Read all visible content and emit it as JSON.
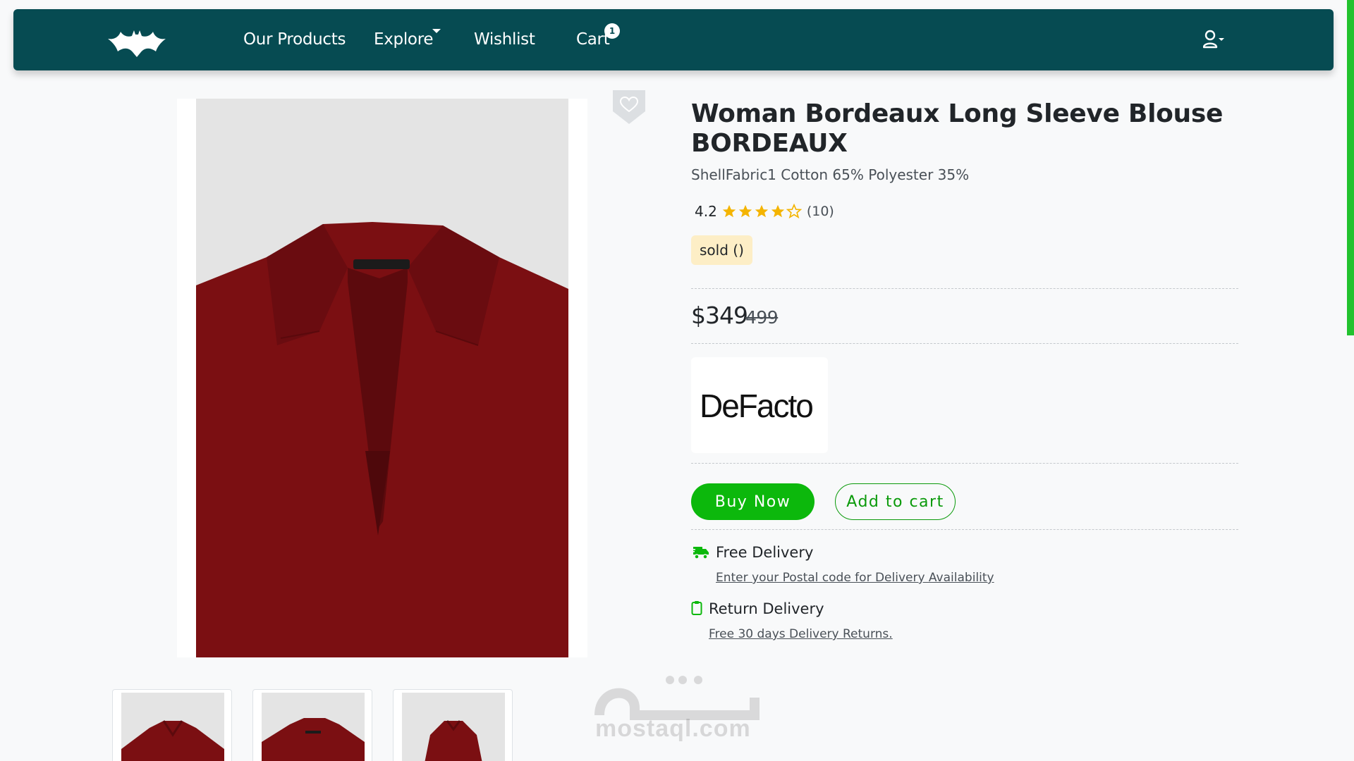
{
  "nav": {
    "logo_icon": "bat-logo-icon",
    "links": [
      "Our Products",
      "Explore",
      "Wishlist",
      "Cart"
    ],
    "cart_count": "1",
    "user_icon": "user-icon"
  },
  "product": {
    "title": "Woman Bordeaux Long Sleeve Blouse BORDEAUX",
    "material": "ShellFabric1 Cotton 65% Polyester 35%",
    "rating": "4.2",
    "rating_stars": 4.2,
    "rating_count": "(10)",
    "sold_label": "sold ()",
    "price": "$349",
    "old_price": "499",
    "brand": "DeFacto",
    "shirt_color": "#7b0f12"
  },
  "actions": {
    "buy_now": "Buy Now",
    "add_to_cart": "Add to cart"
  },
  "delivery": {
    "free_title": "Free Delivery",
    "free_link": "Enter your Postal code for Delivery Availability",
    "return_title": "Return Delivery",
    "return_link": "Free 30 days Delivery Returns."
  },
  "watermark": {
    "text": "mostaql.com"
  },
  "colors": {
    "navbar": "#064b52",
    "accent_green": "#0cb80c",
    "star": "#f4b400"
  }
}
